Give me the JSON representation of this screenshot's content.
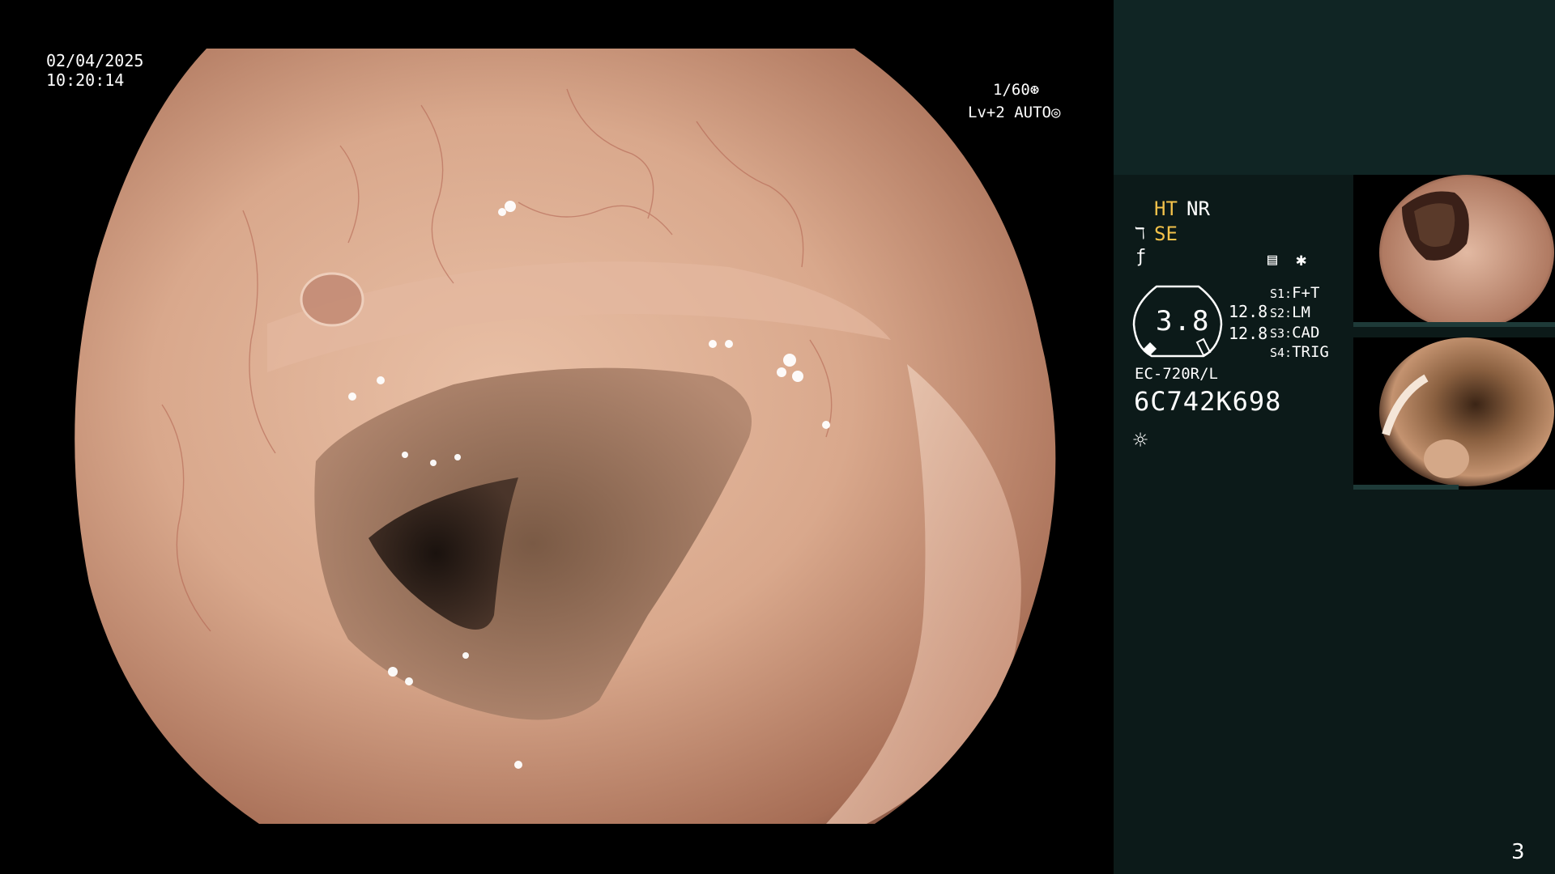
{
  "overlay": {
    "date": "02/04/2025",
    "time": "10:20:14",
    "shutter": "1/60",
    "level": "Lv+2 AUTO"
  },
  "panel": {
    "ht": "HT",
    "nr": "NR",
    "se": "SE",
    "gauge_value": "3.8",
    "value1": "12.8",
    "value2": "12.8",
    "settings": [
      {
        "key": "S1:",
        "value": "F+T"
      },
      {
        "key": "S2:",
        "value": "LM"
      },
      {
        "key": "S3:",
        "value": "CAD"
      },
      {
        "key": "S4:",
        "value": "TRIG"
      }
    ],
    "model": "EC-720R/L",
    "serial": "6C742K698"
  },
  "page_number": "3",
  "icons": [
    "shutter-icon",
    "auto-iris-icon",
    "structure-enhance-icon",
    "freeze-icon",
    "memo-icon",
    "asterisk-icon",
    "brightness-icon"
  ],
  "colors": {
    "accent_yellow": "#f2c14a",
    "panel_bg": "#0c1a19",
    "panel_top": "#102524"
  }
}
